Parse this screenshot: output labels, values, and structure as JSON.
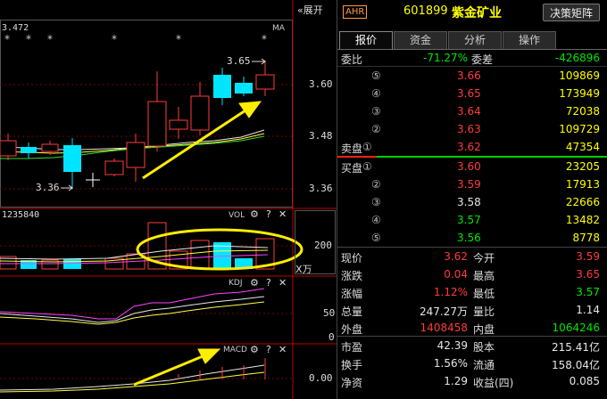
{
  "chart_panel": {
    "top_value": "3.472",
    "ma_label": "MA",
    "expand_button": "«展开",
    "stars": [
      "*",
      "*",
      "*",
      "*",
      "*",
      "*"
    ],
    "price_axis": [
      "3.60",
      "3.48",
      "3.36"
    ],
    "high_annotation": "3.65",
    "low_annotation": "3.36",
    "vol": {
      "label": "VOL",
      "value": "1235840",
      "axis_value": "200",
      "unit": "X万"
    },
    "kdj": {
      "label": "KDJ",
      "axis": [
        "50",
        "0"
      ]
    },
    "macd": {
      "label": "MACD",
      "axis": [
        "0.00"
      ]
    },
    "control_icons": {
      "gear": "⚙",
      "help": "?",
      "close": "✕"
    }
  },
  "stock_header": {
    "badge": "AHR",
    "code": "601899",
    "name": "紫金矿业",
    "button": "决策矩阵"
  },
  "tabs": [
    "报价",
    "资金",
    "分析",
    "操作"
  ],
  "order_book": {
    "weibi_label": "委比",
    "weibi_value": "-71.27%",
    "weicha_label": "委差",
    "weicha_value": "-426896",
    "sell_label": "卖盘",
    "buy_label": "买盘",
    "sells": [
      {
        "level": "⑤",
        "price": "3.66",
        "volume": "109869"
      },
      {
        "level": "④",
        "price": "3.65",
        "volume": "173949"
      },
      {
        "level": "③",
        "price": "3.64",
        "volume": "72038"
      },
      {
        "level": "②",
        "price": "3.63",
        "volume": "109729"
      },
      {
        "level": "①",
        "price": "3.62",
        "volume": "47354"
      }
    ],
    "buys": [
      {
        "level": "①",
        "price": "3.60",
        "volume": "23205"
      },
      {
        "level": "②",
        "price": "3.59",
        "volume": "17913"
      },
      {
        "level": "③",
        "price": "3.58",
        "volume": "22666"
      },
      {
        "level": "④",
        "price": "3.57",
        "volume": "13482"
      },
      {
        "level": "⑤",
        "price": "3.56",
        "volume": "8778"
      }
    ]
  },
  "quote": [
    {
      "l1": "现价",
      "v1": "3.62",
      "c1": "red",
      "l2": "今开",
      "v2": "3.59",
      "c2": "red"
    },
    {
      "l1": "涨跌",
      "v1": "0.04",
      "c1": "red",
      "l2": "最高",
      "v2": "3.65",
      "c2": "red"
    },
    {
      "l1": "涨幅",
      "v1": "1.12%",
      "c1": "red",
      "l2": "最低",
      "v2": "3.57",
      "c2": "green"
    },
    {
      "l1": "总量",
      "v1": "247.27万",
      "c1": "white",
      "l2": "量比",
      "v2": "1.14",
      "c2": "white"
    },
    {
      "l1": "外盘",
      "v1": "1408458",
      "c1": "red",
      "l2": "内盘",
      "v2": "1064246",
      "c2": "green"
    },
    {
      "l1": "市盈",
      "v1": "42.39",
      "c1": "white",
      "l2": "股本",
      "v2": "215.41亿",
      "c2": "white"
    },
    {
      "l1": "换手",
      "v1": "1.56%",
      "c1": "white",
      "l2": "流通",
      "v2": "158.04亿",
      "c2": "white"
    },
    {
      "l1": "净资",
      "v1": "1.29",
      "c1": "white",
      "l2": "收益(四)",
      "v2": "0.085",
      "c2": "white"
    }
  ],
  "colors": {
    "up": "#ff3b3b",
    "down": "#00e5ff",
    "ma_white": "#e8e8e8",
    "ma_yellow": "#ffff44",
    "ma_green": "#33dd33",
    "ma_magenta": "#ff44ff",
    "highlight": "#ffee00"
  }
}
